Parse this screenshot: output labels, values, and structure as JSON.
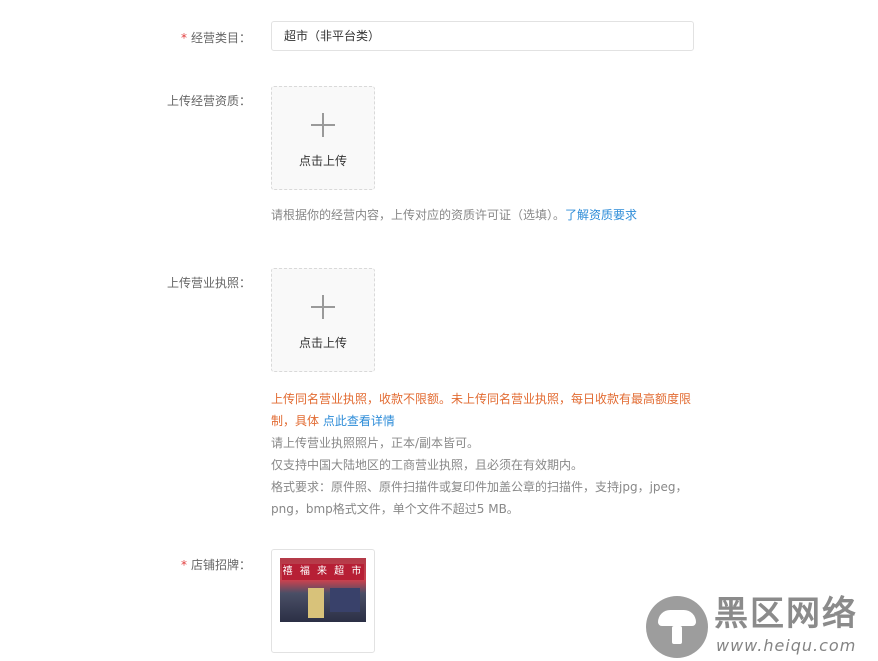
{
  "business_category": {
    "label": "经营类目：",
    "required_mark": "*",
    "value": "超市（非平台类）"
  },
  "qualification": {
    "label": "上传经营资质：",
    "upload_text": "点击上传",
    "hint": "请根据你的经营内容，上传对应的资质许可证（选填）。",
    "hint_link": "了解资质要求"
  },
  "license": {
    "label": "上传营业执照：",
    "upload_text": "点击上传",
    "warn_line1": "上传同名营业执照，收款不限额。未上传同名营业执照，每日收款有最高额度限",
    "warn_line2": "制，具体",
    "warn_link": "点此查看详情",
    "note1": "请上传营业执照照片，正本/副本皆可。",
    "note2": "仅支持中国大陆地区的工商营业执照，且必须在有效期内。",
    "note3": "格式要求：原件照、原件扫描件或复印件加盖公章的扫描件，支持jpg，jpeg，",
    "note4": "png，bmp格式文件，单个文件不超过5 MB。"
  },
  "storefront": {
    "label": "店铺招牌：",
    "required_mark": "*",
    "sign_text": "禧 福 来 超 市"
  },
  "watermark": {
    "title": "黑区网络",
    "url": "www.heiqu.com"
  }
}
